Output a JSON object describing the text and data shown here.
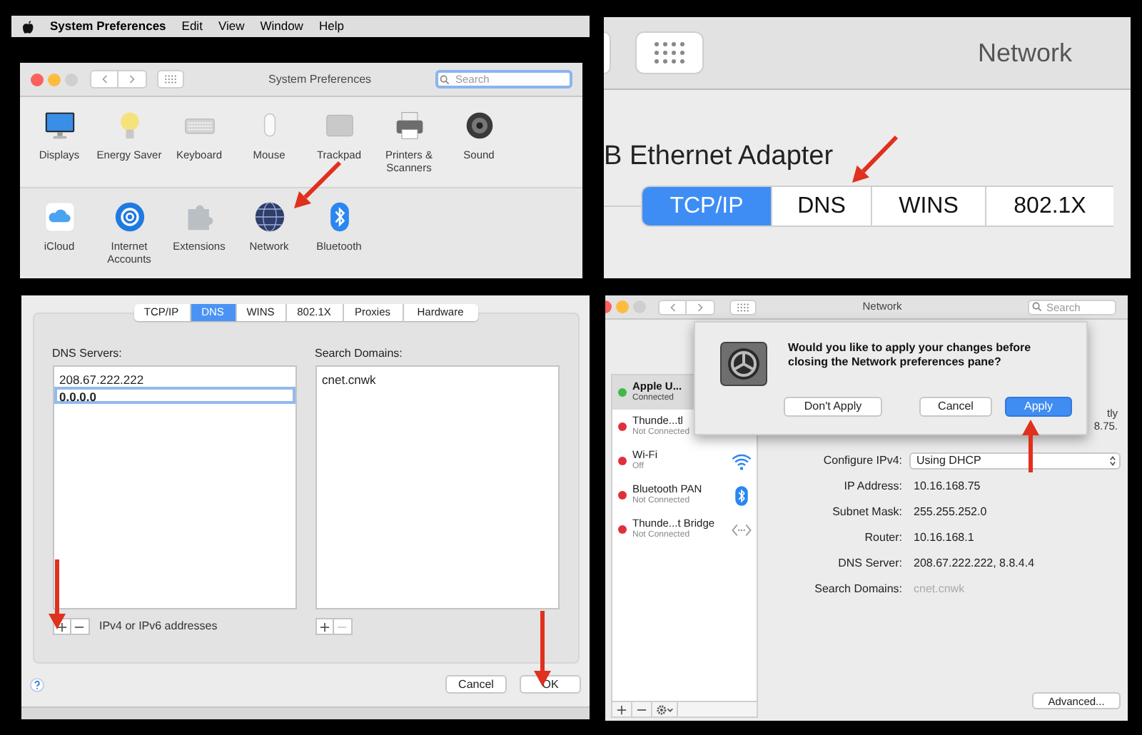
{
  "menu_bar": {
    "app": "System Preferences",
    "items": [
      "Edit",
      "View",
      "Window",
      "Help"
    ]
  },
  "prefs_window": {
    "title": "System Preferences",
    "search": {
      "placeholder": "Search"
    },
    "rows": [
      [
        {
          "label": "Displays"
        },
        {
          "label": "Energy Saver"
        },
        {
          "label": "Keyboard"
        },
        {
          "label": "Mouse"
        },
        {
          "label": "Trackpad"
        },
        {
          "label": "Printers & Scanners"
        },
        {
          "label": "Sound"
        }
      ],
      [
        {
          "label": "iCloud"
        },
        {
          "label": "Internet Accounts"
        },
        {
          "label": "Extensions"
        },
        {
          "label": "Network"
        },
        {
          "label": "Bluetooth"
        }
      ]
    ]
  },
  "zoomed_network": {
    "title": "Network",
    "adapter": "B Ethernet Adapter",
    "tabs": [
      {
        "label": "TCP/IP",
        "selected": true
      },
      {
        "label": "DNS",
        "selected": false
      },
      {
        "label": "WINS",
        "selected": false
      },
      {
        "label": "802.1X",
        "selected": false
      }
    ]
  },
  "dns_sheet": {
    "tabs": [
      {
        "label": "TCP/IP",
        "selected": false
      },
      {
        "label": "DNS",
        "selected": true
      },
      {
        "label": "WINS",
        "selected": false
      },
      {
        "label": "802.1X",
        "selected": false
      },
      {
        "label": "Proxies",
        "selected": false
      },
      {
        "label": "Hardware",
        "selected": false
      }
    ],
    "servers": {
      "label": "DNS Servers:",
      "entries": [
        {
          "text": "208.67.222.222",
          "selected": false
        },
        {
          "text": "0.0.0.0",
          "selected": true
        }
      ],
      "hint": "IPv4 or IPv6 addresses"
    },
    "domains": {
      "label": "Search Domains:",
      "entries": [
        {
          "text": "cnet.cnwk",
          "selected": false
        }
      ]
    },
    "buttons": [
      "Cancel",
      "OK"
    ]
  },
  "network_window": {
    "title": "Network",
    "search": {
      "placeholder": "Search"
    },
    "services": [
      {
        "name": "Apple U...",
        "status": "Connected",
        "color": "#3fb94a",
        "selected": true
      },
      {
        "name": "Thunde...tl",
        "status": "Not Connected",
        "color": "#e0303a",
        "selected": false
      },
      {
        "name": "Wi-Fi",
        "status": "Off",
        "color": "#e0303a",
        "selected": false
      },
      {
        "name": "Bluetooth PAN",
        "status": "Not Connected",
        "color": "#e0303a",
        "selected": false
      },
      {
        "name": "Thunde...t Bridge",
        "status": "Not Connected",
        "color": "#e0303a",
        "selected": false
      }
    ],
    "status_fragments": [
      "tly",
      "8.75."
    ],
    "details": [
      {
        "label": "Configure IPv4:",
        "value": "Using DHCP",
        "kind": "popup"
      },
      {
        "label": "IP Address:",
        "value": "10.16.168.75",
        "kind": "value"
      },
      {
        "label": "Subnet Mask:",
        "value": "255.255.252.0",
        "kind": "value"
      },
      {
        "label": "Router:",
        "value": "10.16.168.1",
        "kind": "value"
      },
      {
        "label": "DNS Server:",
        "value": "208.67.222.222, 8.8.4.4",
        "kind": "value"
      },
      {
        "label": "Search Domains:",
        "placeholder": "cnet.cnwk",
        "kind": "value"
      }
    ],
    "advanced_button": "Advanced...",
    "dialog": {
      "message": "Would you like to apply your changes before closing the Network preferences pane?",
      "buttons": [
        {
          "label": "Don't Apply",
          "default": false
        },
        {
          "label": "Cancel",
          "default": false
        },
        {
          "label": "Apply",
          "default": true
        }
      ]
    }
  }
}
